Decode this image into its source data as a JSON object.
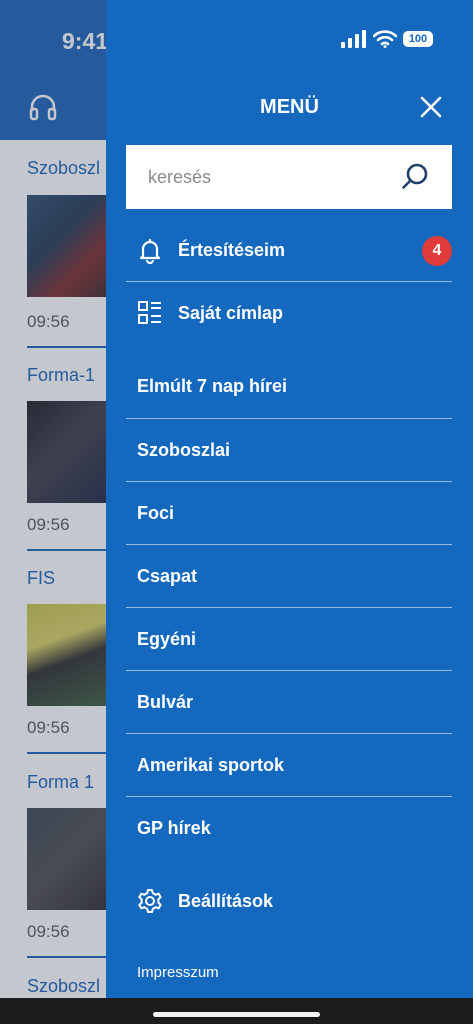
{
  "status_bar": {
    "time": "9:41",
    "battery": "100"
  },
  "background_feed": {
    "articles": [
      {
        "category": "Szoboszl",
        "time": "09:56"
      },
      {
        "category": "Forma-1",
        "time": "09:56"
      },
      {
        "category": "FIS",
        "time": "09:56"
      },
      {
        "category": "Forma 1",
        "time": "09:56"
      },
      {
        "category": "Szoboszl",
        "time": ""
      }
    ]
  },
  "drawer": {
    "title": "MENÜ",
    "search": {
      "placeholder": "keresés",
      "value": ""
    },
    "notifications": {
      "label": "Értesítéseim",
      "count": "4"
    },
    "my_homepage": {
      "label": "Saját címlap"
    },
    "items": [
      {
        "label": "Elmúlt 7 nap hírei"
      },
      {
        "label": "Szoboszlai"
      },
      {
        "label": "Foci"
      },
      {
        "label": "Csapat"
      },
      {
        "label": "Egyéni"
      },
      {
        "label": "Bulvár"
      },
      {
        "label": "Amerikai sportok"
      },
      {
        "label": "GP hírek"
      }
    ],
    "settings": {
      "label": "Beállítások"
    },
    "footer_link": "Impresszum"
  },
  "colors": {
    "drawer_bg": "#1468be",
    "badge": "#e03a3a",
    "header_bg": "#1560b8"
  }
}
